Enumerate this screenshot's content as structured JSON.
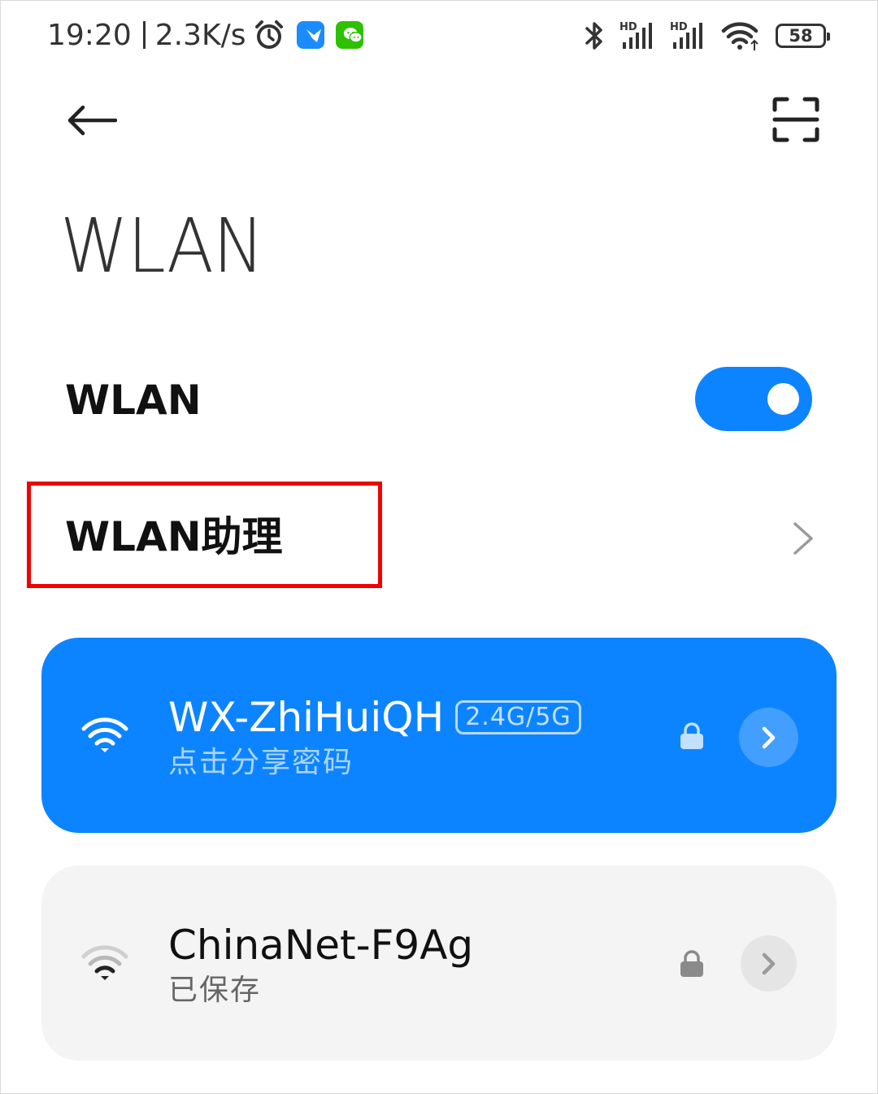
{
  "status_bar": {
    "time": "19:20",
    "net_speed": "2.3K/s",
    "battery": "58",
    "icons": [
      "alarm-icon",
      "feishu-app-icon",
      "wechat-app-icon",
      "bluetooth-icon",
      "hd-signal-icon",
      "hd-signal-icon",
      "wifi-icon",
      "battery-icon"
    ]
  },
  "header": {
    "title": "WLAN",
    "back_icon": "back-arrow-icon",
    "scan_icon": "scan-icon"
  },
  "wlan_toggle": {
    "label": "WLAN",
    "enabled": true,
    "color": "#0d84ff"
  },
  "assistant": {
    "label": "WLAN助理",
    "highlight_color": "#f00000"
  },
  "networks": [
    {
      "name": "WX-ZhiHuiQH",
      "band": "2.4G/5G",
      "subtitle": "点击分享密码",
      "secured": true,
      "connected": true,
      "color": "#0d84ff"
    },
    {
      "name": "ChinaNet-F9Ag",
      "band": "",
      "subtitle": "已保存",
      "secured": true,
      "connected": false,
      "color": "#f4f4f4"
    }
  ]
}
